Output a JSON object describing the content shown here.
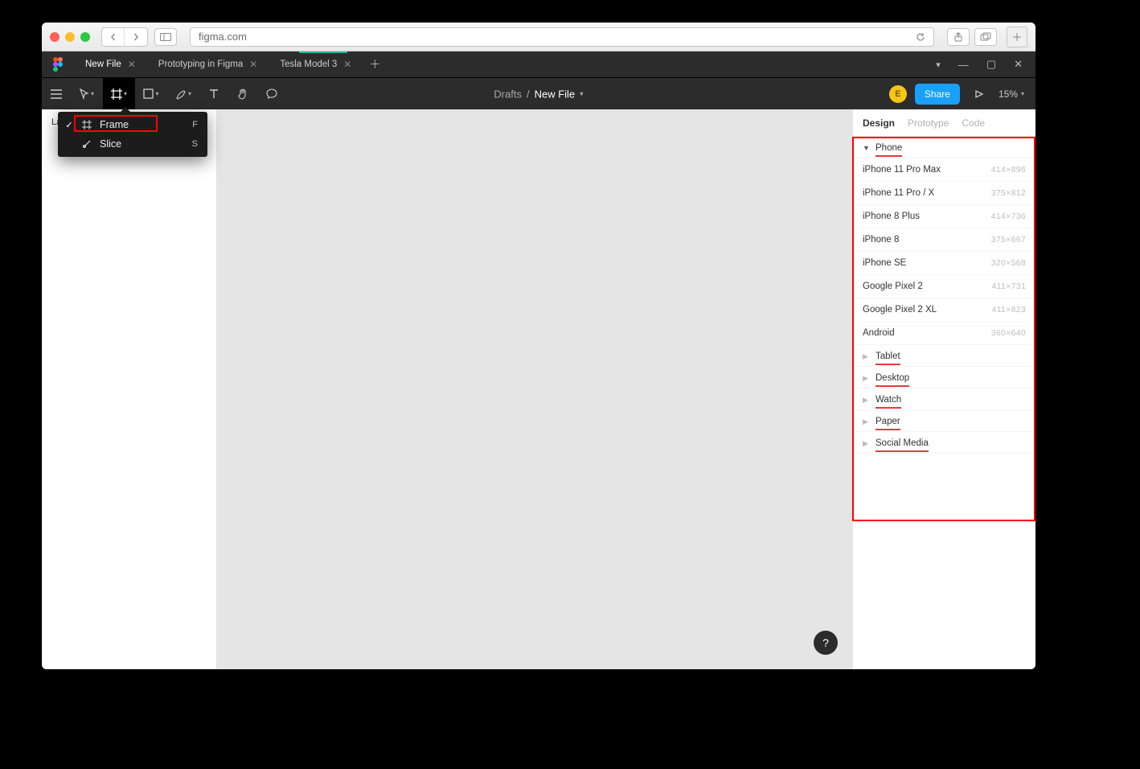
{
  "browser": {
    "url": "figma.com"
  },
  "tabs": {
    "items": [
      {
        "label": "New File",
        "active": true
      },
      {
        "label": "Prototyping in Figma",
        "active": false
      },
      {
        "label": "Tesla Model 3",
        "active": false
      }
    ]
  },
  "breadcrumb": {
    "folder": "Drafts",
    "sep": "/",
    "file": "New File"
  },
  "toolbar": {
    "share": "Share",
    "zoom": "15%",
    "avatar": "E"
  },
  "left_panel": {
    "layers_label": "La"
  },
  "tool_menu": {
    "items": [
      {
        "label": "Frame",
        "shortcut": "F",
        "checked": true,
        "icon": "frame"
      },
      {
        "label": "Slice",
        "shortcut": "S",
        "checked": false,
        "icon": "slice"
      }
    ]
  },
  "right_panel": {
    "tabs": {
      "design": "Design",
      "prototype": "Prototype",
      "code": "Code"
    },
    "sections": [
      {
        "name": "Phone",
        "expanded": true,
        "presets": [
          {
            "name": "iPhone 11 Pro Max",
            "dims": "414×896"
          },
          {
            "name": "iPhone 11 Pro / X",
            "dims": "375×812"
          },
          {
            "name": "iPhone 8 Plus",
            "dims": "414×736"
          },
          {
            "name": "iPhone 8",
            "dims": "375×667"
          },
          {
            "name": "iPhone SE",
            "dims": "320×568"
          },
          {
            "name": "Google Pixel 2",
            "dims": "411×731"
          },
          {
            "name": "Google Pixel 2 XL",
            "dims": "411×823"
          },
          {
            "name": "Android",
            "dims": "360×640"
          }
        ]
      },
      {
        "name": "Tablet",
        "expanded": false,
        "presets": []
      },
      {
        "name": "Desktop",
        "expanded": false,
        "presets": []
      },
      {
        "name": "Watch",
        "expanded": false,
        "presets": []
      },
      {
        "name": "Paper",
        "expanded": false,
        "presets": []
      },
      {
        "name": "Social Media",
        "expanded": false,
        "presets": []
      }
    ]
  },
  "help": "?"
}
